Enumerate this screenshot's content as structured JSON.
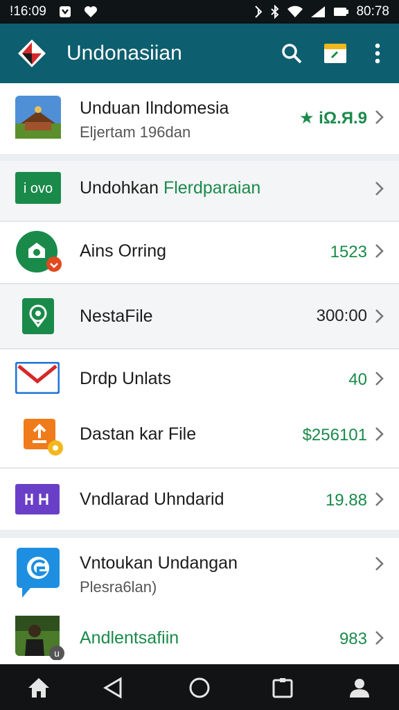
{
  "status_bar": {
    "time": "!16:09",
    "clock_right": "80:78",
    "icons": [
      "download-box-icon",
      "heart-icon",
      "nfc-icon",
      "bluetooth-icon",
      "wifi-icon",
      "signal-icon",
      "battery-icon"
    ]
  },
  "app_bar": {
    "title": "Undonasiian",
    "actions": [
      "search-icon",
      "folder-icon",
      "more-vert-icon"
    ],
    "color": "#0d5e6e"
  },
  "items": [
    {
      "title": "Unduan Ilndomesia",
      "subtitle": "Eljertam 196dan",
      "value": "★ iΩ.Я.9",
      "icon": "mosque-photo-icon"
    },
    {
      "title_prefix": "Undohkan ",
      "title_accent": "Flerdparaian",
      "value": "",
      "icon": "iovo-logo-icon"
    },
    {
      "title": "Ains Orring",
      "value": "1523",
      "icon": "green-camera-icon"
    },
    {
      "title": "NestaFile",
      "value": "300:00",
      "icon": "green-location-icon"
    },
    {
      "title": "Drdp Unlats",
      "value": "40",
      "icon": "mail-icon"
    },
    {
      "title": "Dastan kar File",
      "value": "$256101",
      "icon": "orange-upload-icon"
    },
    {
      "title": "Vndlarad Uhndarid",
      "value": "19.88",
      "icon": "purple-app-icon"
    },
    {
      "title": "Vntoukan Undangan",
      "subtitle": "Plesra6lan)",
      "value": "",
      "icon": "blue-chat-icon"
    },
    {
      "title": "Andlentsafiin",
      "value": "983",
      "icon": "person-photo-icon"
    }
  ],
  "colors": {
    "accent_green": "#1a8a4a",
    "divider": "#e2e5e7"
  },
  "nav_bar": [
    "home-icon",
    "back-icon",
    "circle-home-icon",
    "recent-apps-icon",
    "profile-icon"
  ]
}
